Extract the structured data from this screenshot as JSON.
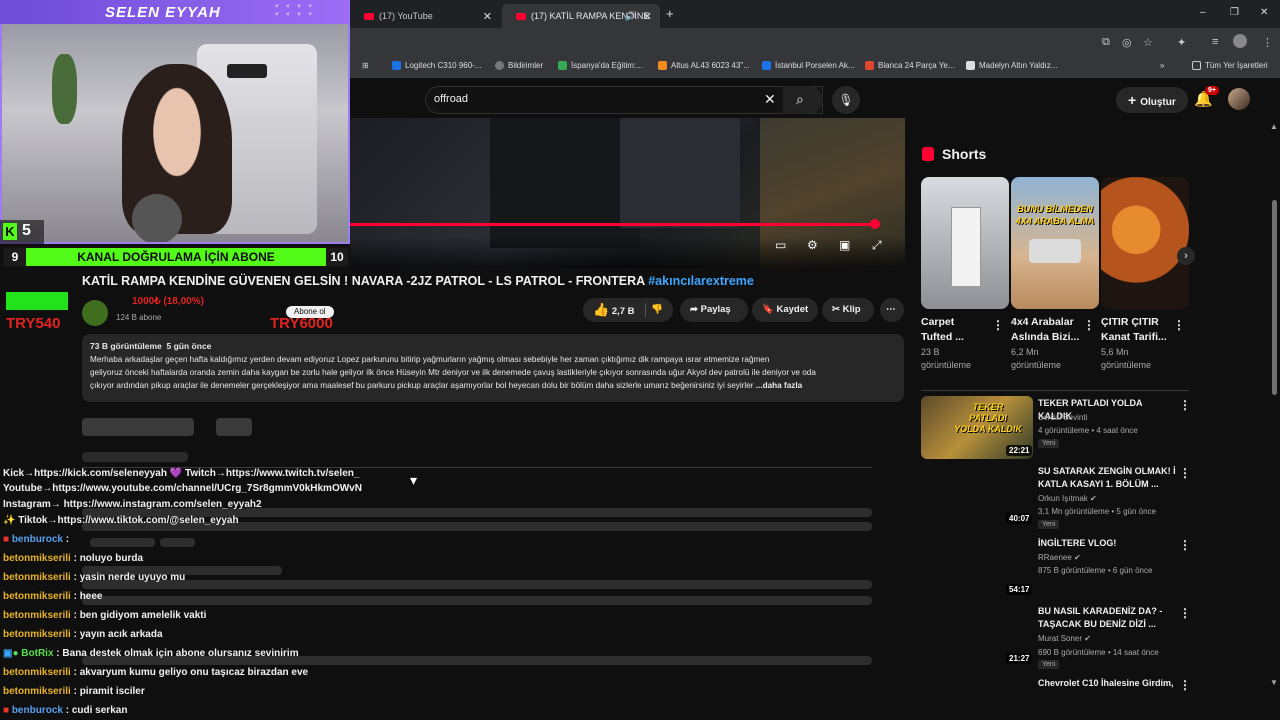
{
  "browser": {
    "tabs": [
      {
        "label": "(17) YouTube",
        "active": false
      },
      {
        "label": "(17) KATİL RAMPA KENDİNE",
        "active": true
      }
    ],
    "bookmarks": [
      "Logitech C310 960-...",
      "Bildirimler",
      "İspanya'da Eğitim:...",
      "Altus AL43 6023 43\"...",
      "İstanbul Porselen Ak...",
      "Blanca 24 Parça Ye...",
      "Madelyn Altın Yaldız...",
      "Tüm Yer İşaretleri"
    ],
    "window_controls": [
      "–",
      "❐",
      "✕"
    ]
  },
  "youtube": {
    "search_value": "offroad",
    "create_label": "Oluştur",
    "notification_count": "9+",
    "video": {
      "title": "KATİL RAMPA KENDİNE GÜVENEN GELSİN ! NAVARA -2JZ PATROL - LS PATROL - FRONTERA",
      "hashtag": "#akıncılarextreme",
      "subscribers": "124 B abone",
      "like_count": "2,7 B",
      "share_label": "Paylaş",
      "save_label": "Kaydet",
      "clip_label": "Klip",
      "views": "73 B görüntüleme",
      "uploaded": "5 gün önce",
      "description_lines": [
        "Merhaba arkadaşlar geçen hafta kaldığımız yerden devam ediyoruz Lopez parkurunu bitirip yağmurların yağmış olması sebebiyle her zaman çıktığımız dik rampaya ısrar etmemize rağmen",
        "geliyoruz önceki haftalarda oranda zemin daha kaygan be zorlu hale geliyor ilk önce Hüseyin Mtr deniyor ve ilk denemede çavuş lastikleriyle çıkıyor sonrasında uğur Akyol dev patrolü ile deniyor ve oda",
        "çıkıyor ardından pikup araçlar ile denemeler gerçekleşiyor ama maalesef bu parkuru pickup araçlar aşamıyorlar bol heyecan dolu bir bölüm daha sizlerle umarız beğenirsiniz iyi seyirler"
      ],
      "more_label": "...daha fazla",
      "subscribe_label": "Abone ol"
    },
    "shorts": {
      "heading": "Shorts",
      "items": [
        {
          "title_lines": [
            "Carpet",
            "Tufted ..."
          ],
          "views_lines": [
            "23 B",
            "görüntüleme"
          ],
          "thumb_text": ""
        },
        {
          "title_lines": [
            "4x4 Arabalar",
            "Aslında Bizi..."
          ],
          "views_lines": [
            "6,2 Mn",
            "görüntüleme"
          ],
          "thumb_text": "BUNU BİLMEDEN 4X4 ARABA ALMA"
        },
        {
          "title_lines": [
            "ÇITIR ÇITIR",
            "Kanat Tarifi..."
          ],
          "views_lines": [
            "5,6 Mn",
            "görüntüleme"
          ],
          "thumb_text": ""
        }
      ]
    },
    "related": [
      {
        "title_lines": [
          "TEKER PATLADI YOLDA KALDIK"
        ],
        "channel": "Serdal Sevinti",
        "meta": "4 görüntüleme • 4 saat önce",
        "badge": "Yeni",
        "duration": "22:21",
        "thumb_text": "TEKER PATLADI YOLDA KALDIK"
      },
      {
        "title_lines": [
          "SU SATARAK ZENGİN OLMAK! İ",
          "KATLA KASAYI 1. BÖLÜM ..."
        ],
        "channel": "Orkun Işıtmak",
        "meta": "3,1 Mn görüntüleme • 5 gün önce",
        "badge": "Yeni",
        "duration": "40:07",
        "thumb_text": ""
      },
      {
        "title_lines": [
          "İNGİLTERE VLOG!"
        ],
        "channel": "RRaenee",
        "meta": "875 B görüntüleme • 6 gün önce",
        "badge": "",
        "duration": "54:17",
        "thumb_text": ""
      },
      {
        "title_lines": [
          "BU NASIL KARADENİZ DA? -",
          "TAŞACAK BU DENİZ DİZİ ..."
        ],
        "channel": "Murat Soner",
        "meta": "690 B görüntüleme • 14 saat önce",
        "badge": "Yeni",
        "duration": "21:27",
        "thumb_text": ""
      },
      {
        "title_lines": [
          "Chevrolet C10 İhalesine Girdim,"
        ],
        "channel": "",
        "meta": "",
        "badge": "",
        "duration": "",
        "thumb_text": ""
      }
    ]
  },
  "stream_overlay": {
    "streamer_name": "SELEN EYYAH",
    "kick_viewers": "5",
    "goal_left": "9",
    "goal_text": "KANAL DOĞRULAMA İÇİN ABONE",
    "goal_right": "10",
    "donation_percent": "1000₺ (18,00%)",
    "donation_left": "TRY540",
    "donation_right": "TRY6000",
    "accent_color": "#53fc18",
    "frame_color": "#9c7df2"
  },
  "chat": {
    "pinned_links": [
      "Kick→https://kick.com/seleneyyah 💜 Twitch→https://www.twitch.tv/selen_",
      "Youtube→https://www.youtube.com/channel/UCrg_7Sr8gmmV0kHkmOWvN",
      "Instagram→ https://www.instagram.com/selen_eyyah2",
      "✨ Tiktok→https://www.tiktok.com/@selen_eyyah"
    ],
    "messages": [
      {
        "user": "benburock",
        "text": "",
        "color": "blue"
      },
      {
        "user": "betonmikserili",
        "text": "noluyo burda",
        "color": "gold"
      },
      {
        "user": "betonmikserili",
        "text": "yasin nerde uyuyo mu",
        "color": "gold"
      },
      {
        "user": "betonmikserili",
        "text": "heee",
        "color": "gold"
      },
      {
        "user": "betonmikserili",
        "text": "ben gidiyom amelelik vakti",
        "color": "gold"
      },
      {
        "user": "betonmikserili",
        "text": "yayın acık arkada",
        "color": "gold"
      },
      {
        "user": "BotRix",
        "text": "Bana destek olmak için abone olursanız sevinirim",
        "color": "green"
      },
      {
        "user": "betonmikserili",
        "text": "akvaryum kumu geliyo onu taşıcaz birazdan eve",
        "color": "gold"
      },
      {
        "user": "betonmikserili",
        "text": "piramit isciler",
        "color": "gold"
      },
      {
        "user": "benburock",
        "text": "cudi serkan",
        "color": "blue"
      }
    ]
  }
}
